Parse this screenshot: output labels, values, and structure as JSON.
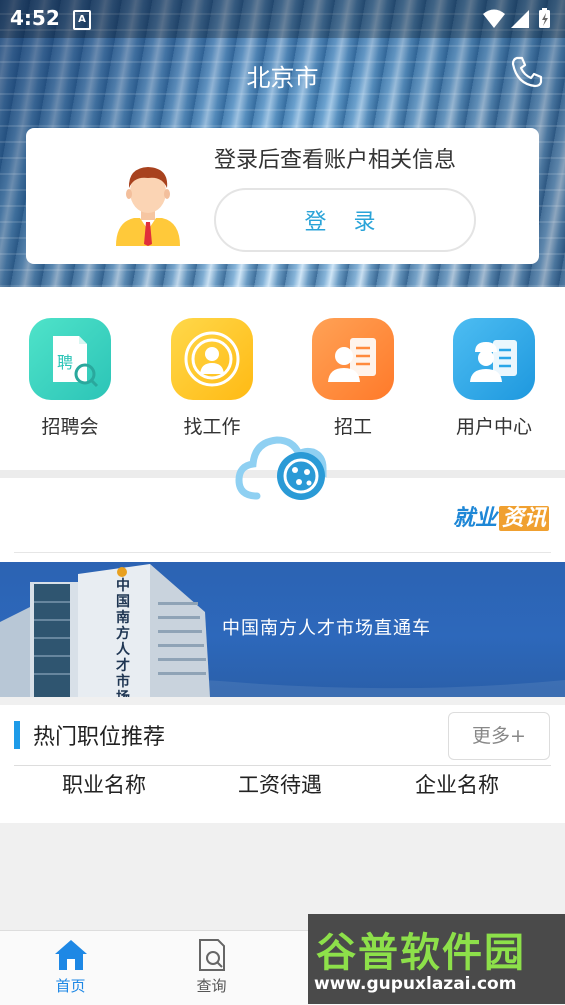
{
  "status_bar": {
    "time": "4:52",
    "notification": "A"
  },
  "header": {
    "city": "北京市"
  },
  "login": {
    "tip": "登录后查看账户相关信息",
    "button": "登 录"
  },
  "quick_menu": [
    {
      "label": "招聘会",
      "icon": "job-fair-icon",
      "color": "#3fd6bf"
    },
    {
      "label": "找工作",
      "icon": "find-job-icon",
      "color": "#ffc21e"
    },
    {
      "label": "招工",
      "icon": "recruit-icon",
      "color": "#ff8a3d"
    },
    {
      "label": "用户中心",
      "icon": "user-center-icon",
      "color": "#2aa6e8"
    }
  ],
  "news": {
    "tag_part1": "就业",
    "tag_part2": "资讯"
  },
  "banner": {
    "text": "中国南方人才市场直通车",
    "building_sign": "中国南方人才市场"
  },
  "hot_jobs": {
    "title": "热门职位推荐",
    "more": "更多+",
    "columns": [
      "职业名称",
      "工资待遇",
      "企业名称"
    ]
  },
  "tabbar": [
    {
      "label": "首页",
      "active": true
    },
    {
      "label": "查询",
      "active": false
    }
  ],
  "watermark": {
    "brand": "谷普软件园",
    "url": "www.gupuxlazai.com"
  }
}
